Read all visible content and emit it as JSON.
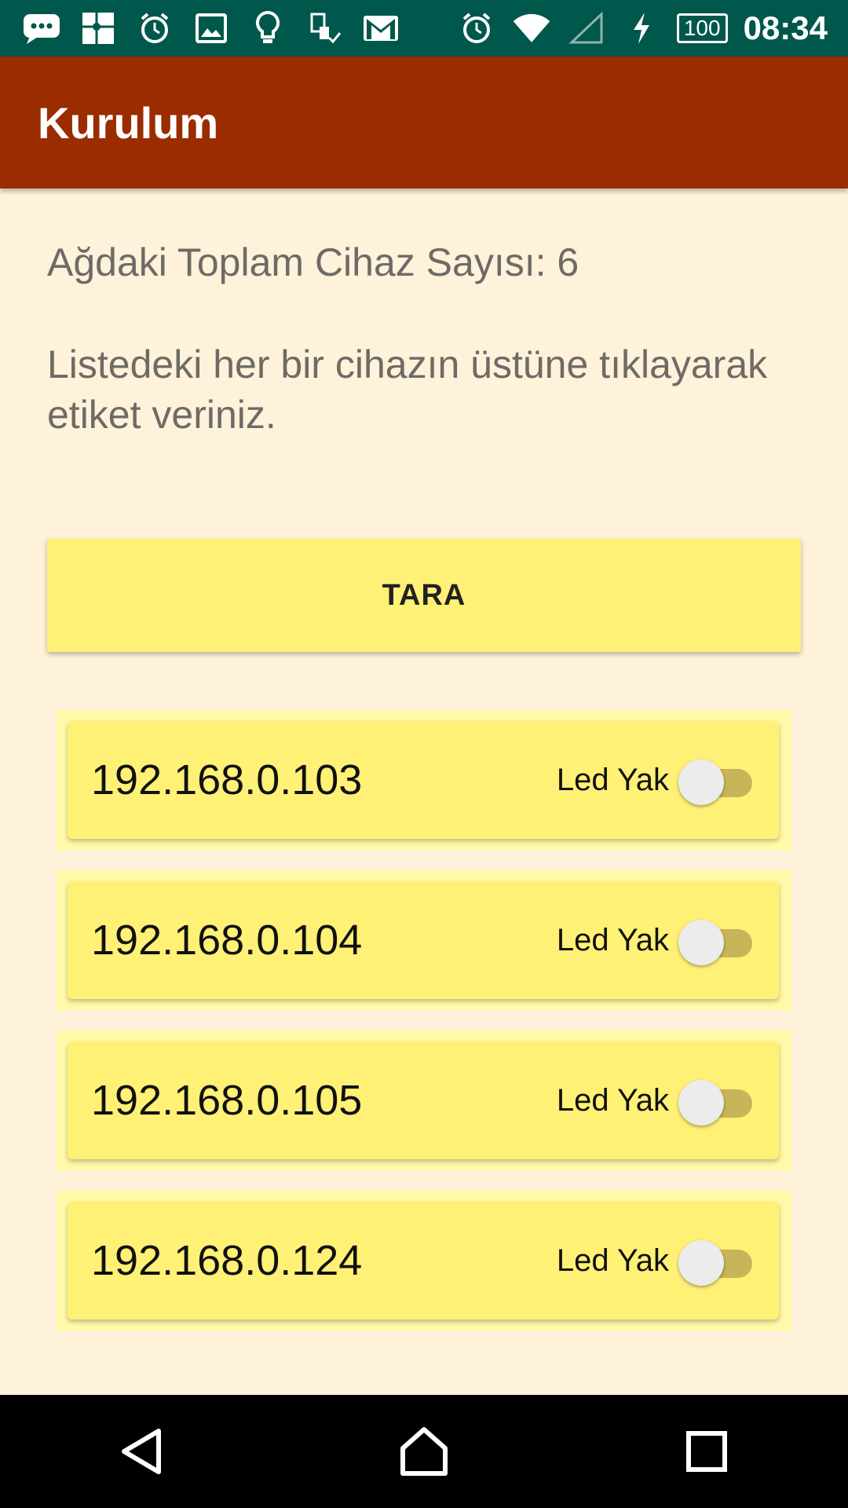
{
  "status_bar": {
    "time": "08:34",
    "battery": "100",
    "icons": [
      "chat-icon",
      "puzzle-icon",
      "alarm-icon",
      "image-icon",
      "lightbulb-icon",
      "sim-icon",
      "gmail-icon"
    ],
    "right_icons": [
      "alarm-icon",
      "wifi-icon",
      "signal-icon",
      "charging-icon"
    ]
  },
  "app_bar": {
    "title": "Kurulum"
  },
  "main": {
    "device_count_text": "Ağdaki Toplam Cihaz Sayısı: 6",
    "instruction_text": "Listedeki her bir cihazın üstüne tıklayarak etiket veriniz.",
    "scan_button_label": "TARA"
  },
  "devices": [
    {
      "ip": "192.168.0.103",
      "toggle_label": "Led Yak",
      "led_on": false
    },
    {
      "ip": "192.168.0.104",
      "toggle_label": "Led Yak",
      "led_on": false
    },
    {
      "ip": "192.168.0.105",
      "toggle_label": "Led Yak",
      "led_on": false
    },
    {
      "ip": "192.168.0.124",
      "toggle_label": "Led Yak",
      "led_on": false
    }
  ],
  "colors": {
    "status_bar": "#00574B",
    "app_bar": "#9A2C00",
    "background": "#FFF2DA",
    "card": "#FFF176",
    "toggle_track": "#C6B559"
  },
  "nav_bar": {
    "icons": [
      "back-icon",
      "home-icon",
      "recents-icon"
    ]
  }
}
